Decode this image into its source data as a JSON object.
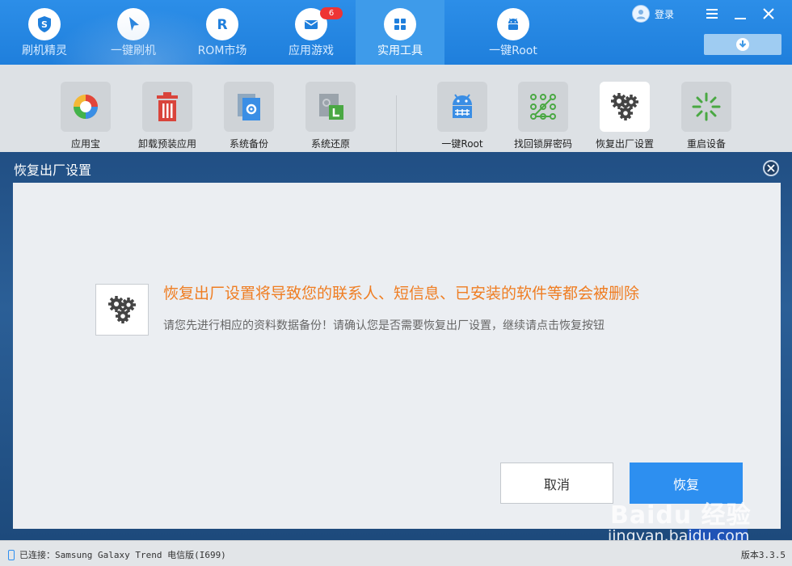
{
  "nav": {
    "tabs": [
      {
        "label": "刷机精灵",
        "icon": "shield-s-icon"
      },
      {
        "label": "一键刷机",
        "icon": "cursor-icon"
      },
      {
        "label": "ROM市场",
        "icon": "rom-r-icon"
      },
      {
        "label": "应用游戏",
        "icon": "envelope-icon",
        "badge": "6"
      },
      {
        "label": "实用工具",
        "icon": "grid-icon",
        "active": true
      },
      {
        "label": "一键Root",
        "icon": "android-icon"
      }
    ],
    "login_label": "登录"
  },
  "tools": [
    {
      "label": "应用宝",
      "icon": "app-store-icon"
    },
    {
      "label": "卸载预装应用",
      "icon": "trash-icon"
    },
    {
      "label": "系统备份",
      "icon": "backup-icon"
    },
    {
      "label": "系统还原",
      "icon": "restore-icon"
    },
    {
      "label": "一键Root",
      "icon": "android-root-icon"
    },
    {
      "label": "找回锁屏密码",
      "icon": "pattern-lock-icon"
    },
    {
      "label": "恢复出厂设置",
      "icon": "gears-icon",
      "selected": true
    },
    {
      "label": "重启设备",
      "icon": "restart-icon"
    }
  ],
  "dialog": {
    "title": "恢复出厂设置",
    "message_title": "恢复出厂设置将导致您的联系人、短信息、已安装的软件等都会被删除",
    "message_sub": "请您先进行相应的资料数据备份！请确认您是否需要恢复出厂设置，继续请点击恢复按钮",
    "cancel_label": "取消",
    "restore_label": "恢复"
  },
  "watermark": {
    "brand": "Baidu 经验",
    "url": "jingyan.baidu.com"
  },
  "status": {
    "connection": "已连接：Samsung Galaxy Trend 电信版(I699)",
    "version": "版本3.3.5"
  },
  "colors": {
    "accent": "#2d8ff0",
    "warning_text": "#ef7d22",
    "badge": "#ee3434"
  }
}
